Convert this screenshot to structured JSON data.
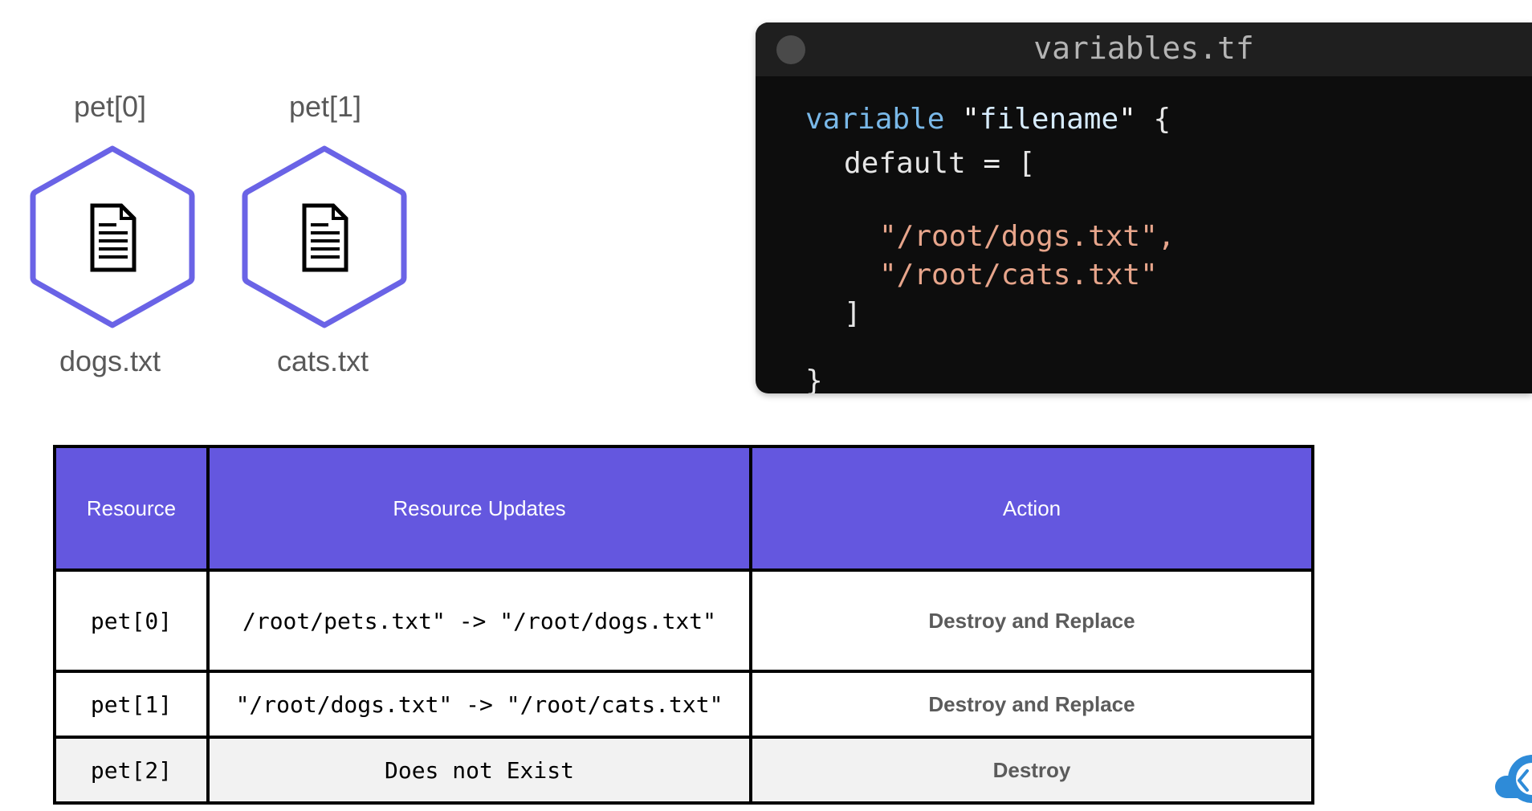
{
  "resources": [
    {
      "index_label": "pet[0]",
      "file_label": "dogs.txt",
      "icon": "document-icon"
    },
    {
      "index_label": "pet[1]",
      "file_label": "cats.txt",
      "icon": "document-icon"
    }
  ],
  "editor": {
    "title": "variables.tf",
    "code": {
      "keyword": "variable",
      "quote_open": "\"",
      "name": "filename",
      "quote_close": "\"",
      "brace_open": " {",
      "default_line": "default = [",
      "item1": "\"/root/dogs.txt\",",
      "item2": "\"/root/cats.txt\"",
      "bracket_close": "]",
      "brace_close": "}"
    }
  },
  "table": {
    "headers": [
      "Resource",
      "Resource Updates",
      "Action"
    ],
    "rows": [
      {
        "resource": "pet[0]",
        "update": "/root/pets.txt\" -> \"/root/dogs.txt\"",
        "action": "Destroy and Replace"
      },
      {
        "resource": "pet[1]",
        "update": "\"/root/dogs.txt\" -> \"/root/cats.txt\"",
        "action": "Destroy and Replace"
      },
      {
        "resource": "pet[2]",
        "update": "Does not Exist",
        "action": "Destroy"
      }
    ]
  },
  "colors": {
    "accent": "#6457df",
    "hex_stroke": "#6a63e6",
    "editor_bg": "#0d0d0d",
    "string": "#e7a58b",
    "keyword": "#79b8e8"
  },
  "logo_icon": "cloud-logo-icon"
}
